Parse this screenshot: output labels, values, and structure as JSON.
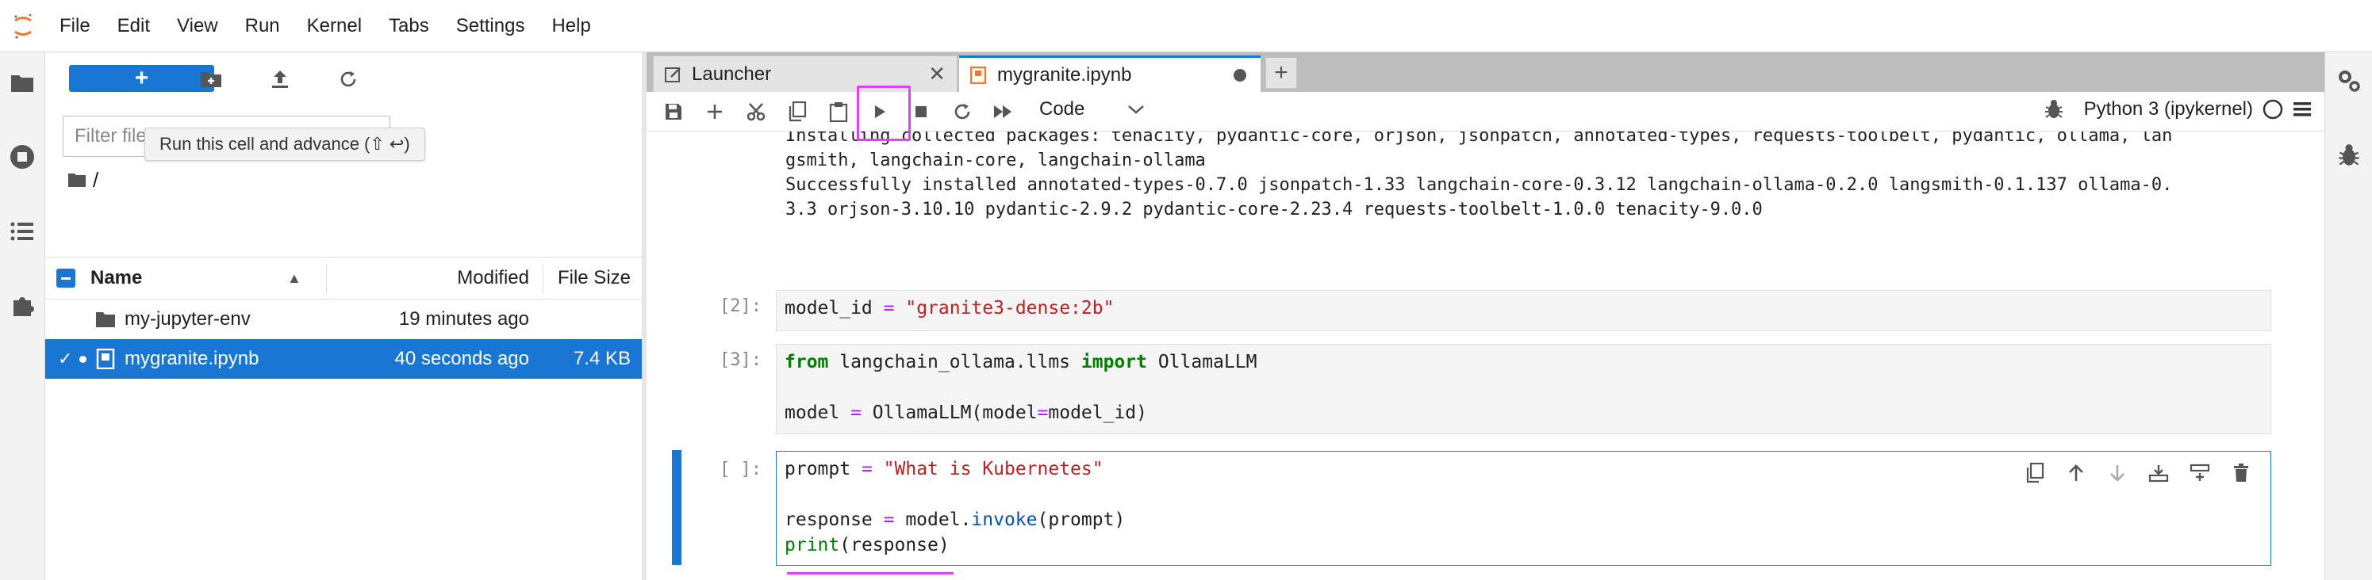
{
  "menubar": {
    "items": [
      "File",
      "Edit",
      "View",
      "Run",
      "Kernel",
      "Tabs",
      "Settings",
      "Help"
    ]
  },
  "leftbar": {
    "icons": [
      "folder-icon",
      "stop-circle-icon",
      "list-icon",
      "puzzle-icon"
    ]
  },
  "rightbar": {
    "icons": [
      "settings-gears-icon",
      "bug-icon"
    ]
  },
  "filebrowser": {
    "new_label": "+",
    "filter_placeholder": "Filter files by name",
    "filter_visible": "Filter file",
    "tooltip": "Run this cell and advance (⇧ ↩)",
    "breadcrumb": "/",
    "columns": {
      "name": "Name",
      "modified": "Modified",
      "size": "File Size"
    },
    "rows": [
      {
        "name": "my-jupyter-env",
        "modified": "19 minutes ago",
        "size": "",
        "type": "folder",
        "selected": false
      },
      {
        "name": "mygranite.ipynb",
        "modified": "40 seconds ago",
        "size": "7.4 KB",
        "type": "notebook",
        "selected": true
      }
    ]
  },
  "tabs": [
    {
      "label": "Launcher",
      "active": false
    },
    {
      "label": "mygranite.ipynb",
      "active": true
    }
  ],
  "toolbar": {
    "cell_type": "Code",
    "kernel": "Python 3 (ipykernel)"
  },
  "notebook": {
    "output_lines": [
      "Installing collected packages: tenacity, pydantic-core, orjson, jsonpatch, annotated-types, requests-toolbelt, pydantic, ollama, lan",
      "gsmith, langchain-core, langchain-ollama",
      "Successfully installed annotated-types-0.7.0 jsonpatch-1.33 langchain-core-0.3.12 langchain-ollama-0.2.0 langsmith-0.1.137 ollama-0.",
      "3.3 orjson-3.10.10 pydantic-2.9.2 pydantic-core-2.23.4 requests-toolbelt-1.0.0 tenacity-9.0.0"
    ],
    "cells": [
      {
        "prompt": "[2]:"
      },
      {
        "prompt": "[3]:"
      },
      {
        "prompt": "[ ]:"
      }
    ]
  },
  "colors": {
    "accent": "#1976d2",
    "highlight": "#e040fb"
  }
}
